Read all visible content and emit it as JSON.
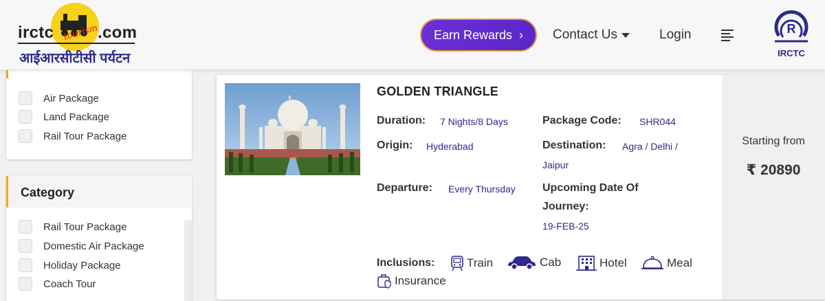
{
  "header": {
    "logo": {
      "left_word": "irctc",
      "right_word": ".com",
      "script_word": "tourism",
      "hindi_name": "आईआरसीटीसी पर्यटन"
    },
    "earn_rewards": "Earn Rewards",
    "contact_us": "Contact Us",
    "login": "Login",
    "emblem_text": "IRCTC"
  },
  "sidebar": {
    "package_types": [
      "Air Package",
      "Land Package",
      "Rail Tour Package"
    ],
    "category": {
      "title": "Category",
      "items": [
        "Rail Tour Package",
        "Domestic Air Package",
        "Holiday Package",
        "Coach Tour"
      ]
    }
  },
  "package": {
    "title": "GOLDEN TRIANGLE",
    "duration_label": "Duration:",
    "duration": "7 Nights/8 Days",
    "code_label": "Package Code:",
    "code": "SHR044",
    "origin_label": "Origin:",
    "origin": "Hyderabad",
    "destination_label": "Destination:",
    "destination_line1": "Agra / Delhi /",
    "destination_line2": "Jaipur",
    "departure_label": "Departure:",
    "departure": "Every Thursday",
    "upcoming_label_line1": "Upcoming Date Of",
    "upcoming_label_line2": "Journey:",
    "upcoming_date": "19-FEB-25",
    "inclusions_label": "Inclusions:",
    "inclusions": [
      {
        "label": "Train",
        "icon": "train-icon"
      },
      {
        "label": "Cab",
        "icon": "car-icon"
      },
      {
        "label": "Hotel",
        "icon": "hotel-icon"
      },
      {
        "label": "Meal",
        "icon": "meal-icon"
      },
      {
        "label": "Insurance",
        "icon": "insurance-icon"
      }
    ],
    "price_label": "Starting from",
    "price": "₹ 20890"
  },
  "colors": {
    "brand_purple": "#5a26c9",
    "accent_orange": "#f5a623",
    "value_navy": "#2a2a8c",
    "icon_navy": "#2d2a8c"
  }
}
